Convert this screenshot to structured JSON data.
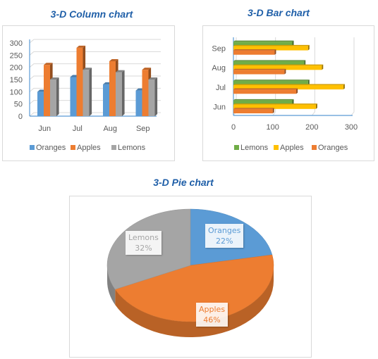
{
  "chart_data": [
    {
      "id": "column",
      "type": "bar",
      "variant": "3d-column",
      "title": "3-D Column chart",
      "categories": [
        "Jun",
        "Jul",
        "Aug",
        "Sep"
      ],
      "series": [
        {
          "name": "Oranges",
          "color": "#5b9bd5",
          "values": [
            100,
            160,
            130,
            105
          ]
        },
        {
          "name": "Apples",
          "color": "#ed7d31",
          "values": [
            210,
            280,
            225,
            190
          ]
        },
        {
          "name": "Lemons",
          "color": "#a5a5a5",
          "values": [
            150,
            190,
            180,
            150
          ]
        }
      ],
      "yticks": [
        "0",
        "50",
        "100",
        "150",
        "200",
        "250",
        "300"
      ],
      "ylim": [
        0,
        300
      ],
      "grid": true,
      "legend": "bottom",
      "xlabel": "",
      "ylabel": ""
    },
    {
      "id": "bar",
      "type": "bar",
      "variant": "3d-horizontal-bar",
      "title": "3-D Bar chart",
      "categories": [
        "Jun",
        "Jul",
        "Aug",
        "Sep"
      ],
      "series": [
        {
          "name": "Lemons",
          "color": "#70ad47",
          "values": [
            150,
            190,
            180,
            150
          ]
        },
        {
          "name": "Apples",
          "color": "#ffc000",
          "values": [
            210,
            280,
            225,
            190
          ]
        },
        {
          "name": "Oranges",
          "color": "#ed7d31",
          "values": [
            100,
            160,
            130,
            105
          ]
        }
      ],
      "xticks": [
        "0",
        "100",
        "200",
        "300"
      ],
      "xlim": [
        0,
        300
      ],
      "grid": true,
      "legend": "bottom",
      "xlabel": "",
      "ylabel": ""
    },
    {
      "id": "pie",
      "type": "pie",
      "variant": "3d-pie",
      "title": "3-D Pie chart",
      "slices": [
        {
          "name": "Oranges",
          "percent": 22,
          "label": "Oranges",
          "pct_label": "22%",
          "color": "#5b9bd5",
          "text_color": "#5b9bd5"
        },
        {
          "name": "Apples",
          "percent": 46,
          "label": "Apples",
          "pct_label": "46%",
          "color": "#ed7d31",
          "text_color": "#ed7d31"
        },
        {
          "name": "Lemons",
          "percent": 32,
          "label": "Lemons",
          "pct_label": "32%",
          "color": "#a5a5a5",
          "text_color": "#a5a5a5"
        }
      ],
      "legend": "none"
    }
  ]
}
